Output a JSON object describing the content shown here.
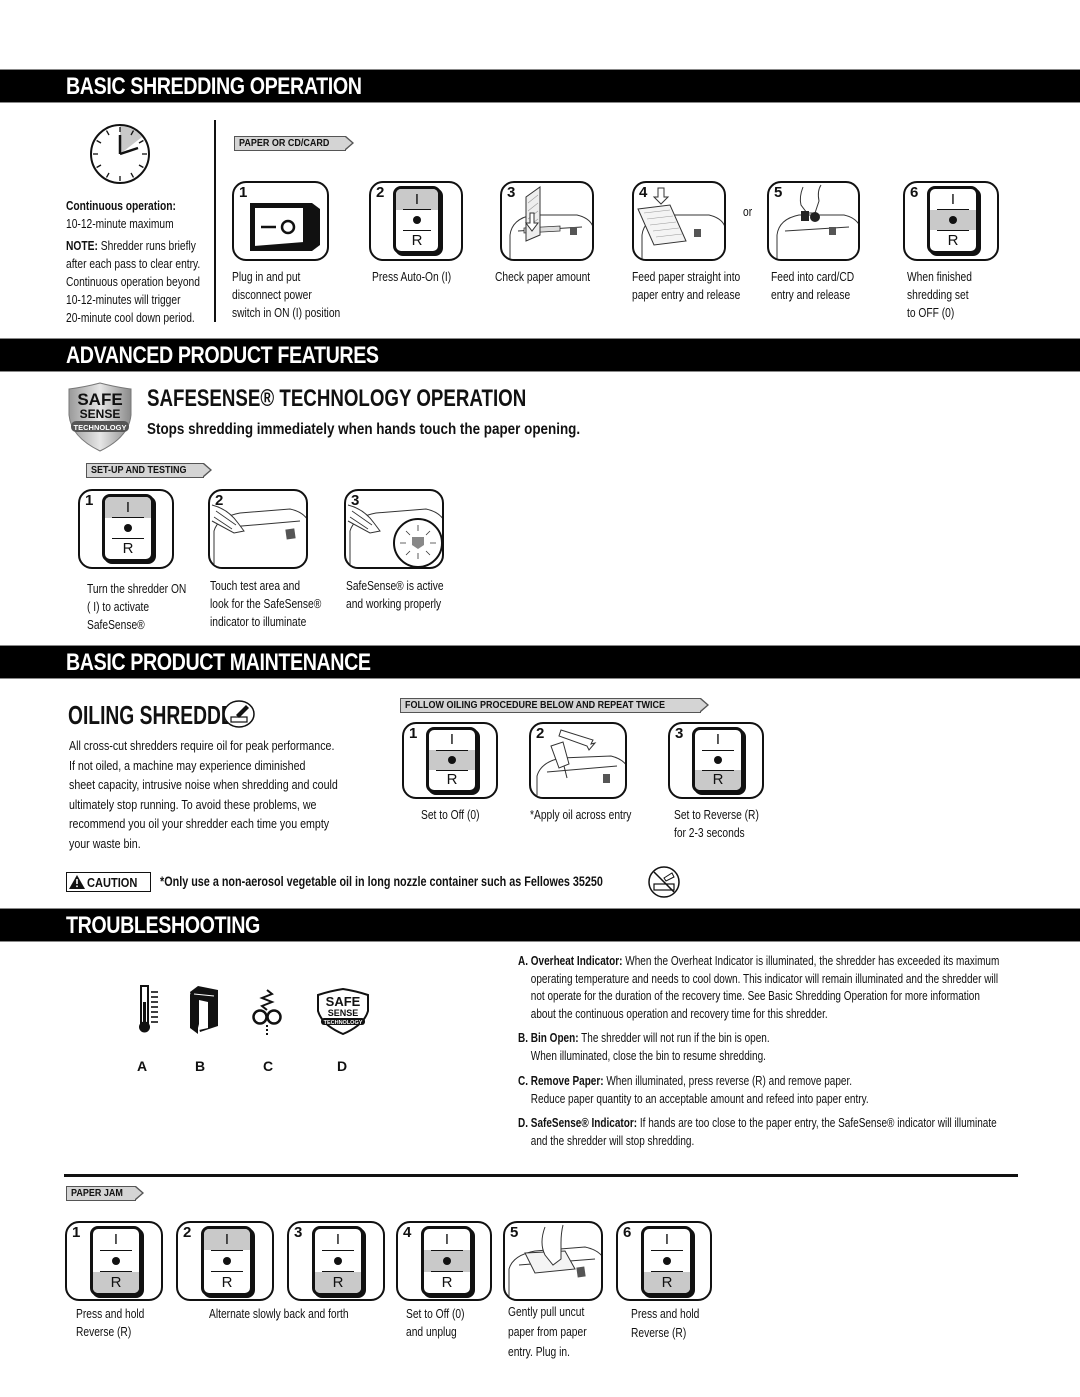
{
  "sections": {
    "basic_shredding": "BASIC SHREDDING OPERATION",
    "advanced_features": "ADVANCED PRODUCT FEATURES",
    "maintenance": "BASIC PRODUCT MAINTENANCE",
    "troubleshooting": "TROUBLESHOOTING"
  },
  "basic_shredding": {
    "continuous_label": "Continuous operation:",
    "continuous_value": "10-12-minute maximum",
    "note_label": "NOTE:",
    "note_lines": [
      " Shredder runs briefly",
      "after each pass to clear entry.",
      "Continuous operation beyond",
      "10-12-minutes will trigger",
      "20-minute cool down period."
    ],
    "tag": "PAPER OR CD/CARD",
    "or_label": "or",
    "steps": [
      {
        "num": "1",
        "icon": "rocker-switch",
        "caption": [
          "Plug in and put",
          "disconnect power",
          "switch in ON (I) position"
        ]
      },
      {
        "num": "2",
        "icon": "control-switch-on",
        "caption": [
          "Press Auto-On (I)"
        ]
      },
      {
        "num": "3",
        "icon": "shredder-check-paper",
        "caption": [
          "Check paper amount"
        ]
      },
      {
        "num": "4",
        "icon": "shredder-feed-paper",
        "caption": [
          "Feed paper straight into",
          "paper entry and release"
        ]
      },
      {
        "num": "5",
        "icon": "shredder-feed-card",
        "caption": [
          "Feed into card/CD",
          "entry and release"
        ]
      },
      {
        "num": "6",
        "icon": "control-switch-off",
        "caption": [
          "When finished",
          "shredding set",
          "to OFF (0)"
        ]
      }
    ]
  },
  "safesense": {
    "badge": {
      "line1": "SAFE",
      "line2": "SENSE",
      "line3": "TECHNOLOGY"
    },
    "title": "SAFESENSE® TECHNOLOGY OPERATION",
    "subtitle": "Stops shredding immediately when hands touch the paper opening.",
    "tag": "SET-UP AND TESTING",
    "steps": [
      {
        "num": "1",
        "icon": "control-switch-on",
        "caption": [
          "Turn the shredder ON",
          "( I) to activate",
          "SafeSense®"
        ]
      },
      {
        "num": "2",
        "icon": "hand-touch-test-area",
        "caption": [
          "Touch test area and",
          "look for the SafeSense®",
          "indicator to illuminate"
        ]
      },
      {
        "num": "3",
        "icon": "safesense-indicator-lit",
        "caption": [
          "SafeSense® is active",
          "and working properly"
        ]
      }
    ]
  },
  "oiling": {
    "title": "OILING SHREDDER",
    "body": [
      "All cross-cut shredders require oil for peak performance.",
      "If not oiled, a machine may experience diminished",
      "sheet capacity, intrusive noise when shredding and could",
      "ultimately stop running. To avoid these problems, we",
      "recommend you oil your shredder each time you empty",
      "your waste bin."
    ],
    "tag": "FOLLOW OILING PROCEDURE BELOW AND REPEAT TWICE",
    "steps": [
      {
        "num": "1",
        "icon": "control-switch-off",
        "caption": [
          "Set to Off (0)"
        ]
      },
      {
        "num": "2",
        "icon": "apply-oil",
        "caption": [
          "*Apply oil across entry"
        ]
      },
      {
        "num": "3",
        "icon": "control-switch-reverse",
        "caption": [
          "Set to Reverse (R)",
          "for 2-3 seconds"
        ]
      }
    ],
    "caution_label": "CAUTION",
    "caution_text": "*Only use a non-aerosol vegetable oil in long nozzle container such as Fellowes 35250"
  },
  "troubleshooting": {
    "icons": [
      {
        "letter": "A",
        "icon": "thermometer"
      },
      {
        "letter": "B",
        "icon": "bin-open"
      },
      {
        "letter": "C",
        "icon": "remove-paper"
      },
      {
        "letter": "D",
        "icon": "safesense-badge"
      }
    ],
    "items": [
      {
        "label": "A. Overheat Indicator:",
        "lines": [
          "  When the Overheat Indicator is illuminated, the shredder has exceeded its maximum",
          "operating temperature and needs to cool down. This indicator will remain illuminated and the shredder will",
          "not operate for the duration of the recovery time. See Basic Shredding Operation for more information",
          "about the continuous operation and recovery time for this shredder."
        ]
      },
      {
        "label": "B. Bin Open:",
        "lines": [
          " The shredder will not run if the bin is open.",
          "When illuminated, close the bin to resume shredding."
        ]
      },
      {
        "label": "C. Remove Paper:",
        "lines": [
          " When illuminated, press reverse (R) and remove paper.",
          "Reduce paper quantity to an acceptable amount and refeed into paper entry."
        ]
      },
      {
        "label": "D. SafeSense® Indicator:",
        "lines": [
          " If hands are too close to the paper entry, the SafeSense® indicator will illuminate",
          "and the shredder will stop shredding."
        ]
      }
    ],
    "paper_jam_tag": "PAPER JAM",
    "jam_steps": [
      {
        "num": "1",
        "icon": "control-switch-reverse"
      },
      {
        "num": "2",
        "icon": "control-switch-on"
      },
      {
        "num": "3",
        "icon": "control-switch-reverse"
      },
      {
        "num": "4",
        "icon": "control-switch-off"
      },
      {
        "num": "5",
        "icon": "pull-paper"
      },
      {
        "num": "6",
        "icon": "control-switch-reverse"
      }
    ],
    "jam_captions": {
      "c1": [
        "Press and hold",
        "Reverse (R)"
      ],
      "c23": [
        "Alternate slowly back and forth"
      ],
      "c4": [
        "Set to Off (0)",
        "and unplug"
      ],
      "c5": [
        "Gently pull uncut",
        "paper from paper",
        "entry. Plug in."
      ],
      "c6": [
        "Press and hold",
        "Reverse (R)"
      ]
    }
  },
  "switch_labels": {
    "top": "I",
    "bottom": "R"
  },
  "colors": {
    "band": "#000000",
    "shade": "#c9c9c9",
    "tag": "#d4d4d4"
  }
}
